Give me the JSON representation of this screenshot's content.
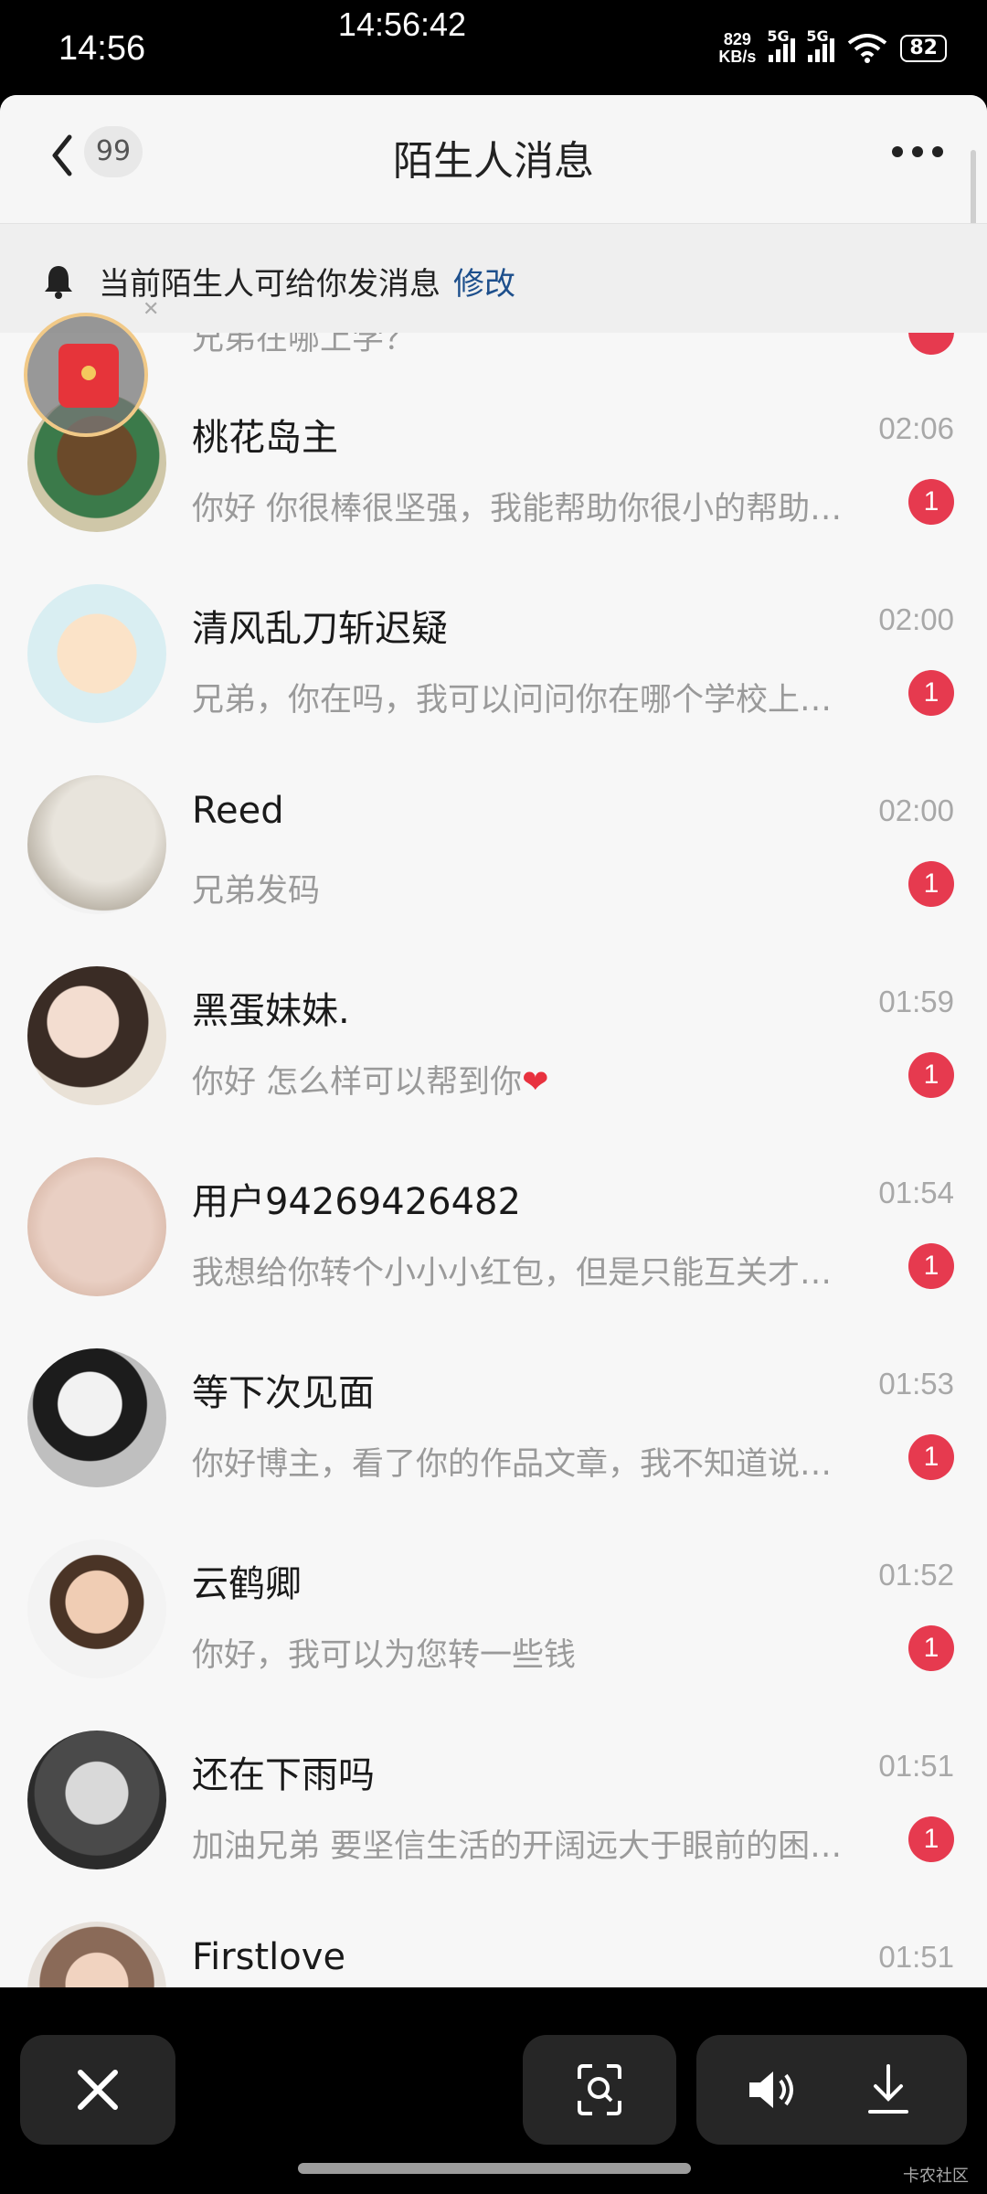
{
  "status_bar": {
    "time": "14:56",
    "clock_overlay": "14:56:42",
    "net_speed_value": "829",
    "net_speed_unit": "KB/s",
    "signal1_label": "5G",
    "signal2_label": "5G",
    "battery": "82"
  },
  "header": {
    "title": "陌生人消息",
    "back_badge": "99"
  },
  "notice": {
    "text": "当前陌生人可给你发消息",
    "link": "修改"
  },
  "partial_top": {
    "preview": "兄弟在哪上学？"
  },
  "conversations": [
    {
      "name": "桃花岛主",
      "time": "02:06",
      "preview": "你好 你很棒很坚强，我能帮助你很小的帮助…",
      "unread": "1"
    },
    {
      "name": "清风乱刀斩迟疑",
      "time": "02:00",
      "preview": "兄弟，你在吗，我可以问问你在哪个学校上…",
      "unread": "1"
    },
    {
      "name": "Reed",
      "time": "02:00",
      "preview": "兄弟发码",
      "unread": "1"
    },
    {
      "name": "黑蛋妹妹.",
      "time": "01:59",
      "preview": "你好 怎么样可以帮到你",
      "unread": "1"
    },
    {
      "name": "用户94269426482",
      "time": "01:54",
      "preview": "我想给你转个小小小红包，但是只能互关才…",
      "unread": "1"
    },
    {
      "name": "等下次见面",
      "time": "01:53",
      "preview": "你好博主，看了你的作品文章，我不知道说…",
      "unread": "1"
    },
    {
      "name": "云鹤卿",
      "time": "01:52",
      "preview": "你好，我可以为您转一些钱",
      "unread": "1"
    },
    {
      "name": "还在下雨吗",
      "time": "01:51",
      "preview": "加油兄弟 要坚信生活的开阔远大于眼前的困…",
      "unread": "1"
    },
    {
      "name": "Firstlove",
      "time": "01:51",
      "preview": "",
      "unread": ""
    }
  ],
  "bottom": {
    "watermark": "卡农社区"
  },
  "icons": {
    "close": "close-icon",
    "scan": "scan-icon",
    "volume": "volume-icon",
    "download": "download-icon"
  },
  "colors": {
    "unread_badge": "#e63a4f",
    "link": "#1d4f8c",
    "background": "#f6f6f6"
  }
}
